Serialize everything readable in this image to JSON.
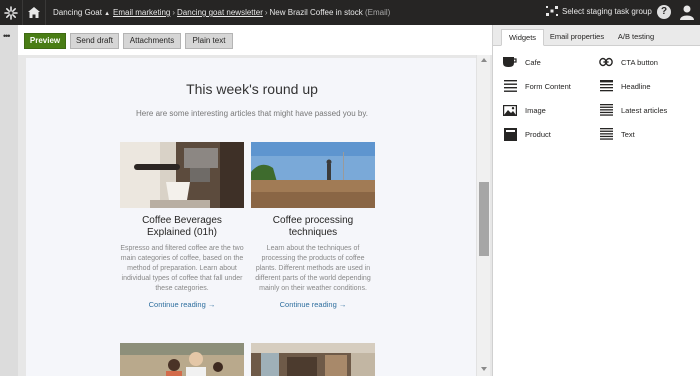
{
  "topbar": {
    "site_name": "Dancing Goat",
    "breadcrumbs": [
      {
        "label": "Email marketing"
      },
      {
        "label": "Dancing goat newsletter"
      },
      {
        "label": "New Brazil Coffee in stock",
        "suffix": "(Email)"
      }
    ],
    "staging_label": "Select staging task group",
    "help_label": "?"
  },
  "toolbar": {
    "preview_label": "Preview",
    "send_draft_label": "Send draft",
    "attachments_label": "Attachments",
    "plain_text_label": "Plain text"
  },
  "email": {
    "heading": "This week's round up",
    "intro": "Here are some interesting articles that might have passed you by.",
    "articles": [
      {
        "title": "Coffee Beverages Explained (01h)",
        "description": "Espresso and filtered coffee are the two main categories of coffee, based on the method of preparation. Learn about individual types of coffee that fall under these categories.",
        "link": "Continue reading →"
      },
      {
        "title": "Coffee processing techniques",
        "description": "Learn about the techniques of processing the products of coffee plants. Different methods are used in different parts of the world depending mainly on their weather conditions.",
        "link": "Continue reading →"
      }
    ]
  },
  "panel": {
    "tabs": [
      "Widgets",
      "Email properties",
      "A/B testing"
    ],
    "active_tab": "Widgets",
    "widgets": [
      {
        "label": "Cafe",
        "icon": "cafe-icon"
      },
      {
        "label": "CTA button",
        "icon": "link-icon"
      },
      {
        "label": "Form Content",
        "icon": "form-icon"
      },
      {
        "label": "Headline",
        "icon": "headline-icon"
      },
      {
        "label": "Image",
        "icon": "image-icon"
      },
      {
        "label": "Latest articles",
        "icon": "list-icon"
      },
      {
        "label": "Product",
        "icon": "product-icon"
      },
      {
        "label": "Text",
        "icon": "text-icon"
      }
    ]
  },
  "colors": {
    "topbar_bg": "#262524",
    "primary_green": "#497d15",
    "link_blue": "#2f6f9f"
  }
}
